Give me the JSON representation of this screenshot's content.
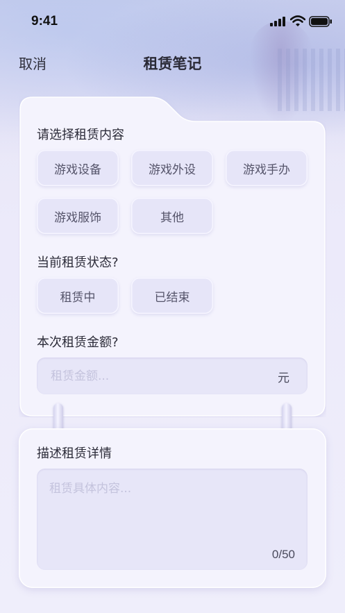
{
  "status_bar": {
    "time": "9:41",
    "icons": [
      "signal-icon",
      "wifi-icon",
      "battery-icon"
    ]
  },
  "nav": {
    "cancel_label": "取消",
    "title": "租赁笔记"
  },
  "form": {
    "content_section": {
      "title": "请选择租赁内容",
      "options": [
        "游戏设备",
        "游戏外设",
        "游戏手办",
        "游戏服饰",
        "其他"
      ]
    },
    "status_section": {
      "title": "当前租赁状态?",
      "options": [
        "租赁中",
        "已结束"
      ]
    },
    "amount_section": {
      "title": "本次租赁金额?",
      "placeholder": "租赁金额...",
      "value": "",
      "unit": "元"
    },
    "detail_section": {
      "title": "描述租赁详情",
      "placeholder": "租赁具体内容...",
      "value": "",
      "counter": "0/50"
    }
  },
  "colors": {
    "background": "#ecebfa",
    "card": "#f4f3fd",
    "chip": "#e6e5f8",
    "placeholder": "#c4c3dd",
    "text": "#2b2b38"
  }
}
